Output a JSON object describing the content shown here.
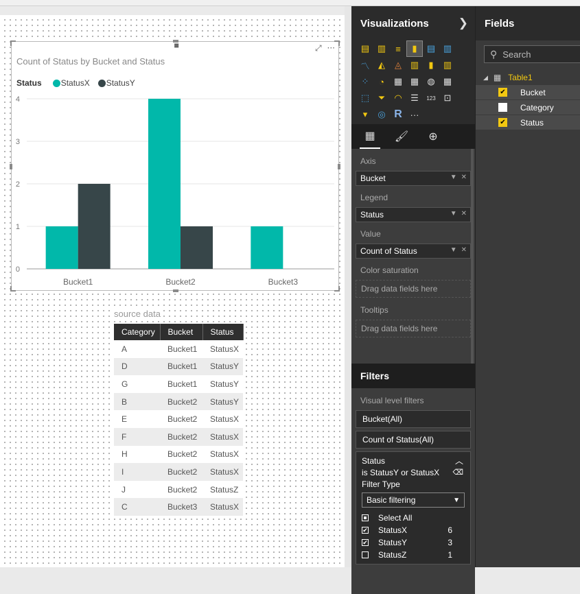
{
  "colors": {
    "statusx": "#01B8AA",
    "statusy": "#374649",
    "accent": "#F2C811"
  },
  "visual": {
    "title": "Count of Status by Bucket and Status",
    "legend_title": "Status",
    "legend": [
      "StatusX",
      "StatusY"
    ],
    "icons": [
      "focus-mode-icon",
      "more-options-icon"
    ]
  },
  "chart_data": {
    "type": "bar",
    "title": "Count of Status by Bucket and Status",
    "categories": [
      "Bucket1",
      "Bucket2",
      "Bucket3"
    ],
    "series": [
      {
        "name": "StatusX",
        "values": [
          1,
          4,
          1
        ]
      },
      {
        "name": "StatusY",
        "values": [
          2,
          1,
          0
        ]
      }
    ],
    "yticks": [
      "0",
      "1",
      "2",
      "3",
      "4"
    ],
    "ylim": [
      0,
      4
    ],
    "grid": true,
    "legend_position": "top-left"
  },
  "source": {
    "label": "source data",
    "headers": [
      "Category",
      "Bucket",
      "Status"
    ],
    "rows": [
      [
        "A",
        "Bucket1",
        "StatusX"
      ],
      [
        "D",
        "Bucket1",
        "StatusY"
      ],
      [
        "G",
        "Bucket1",
        "StatusY"
      ],
      [
        "B",
        "Bucket2",
        "StatusY"
      ],
      [
        "E",
        "Bucket2",
        "StatusX"
      ],
      [
        "F",
        "Bucket2",
        "StatusX"
      ],
      [
        "H",
        "Bucket2",
        "StatusX"
      ],
      [
        "I",
        "Bucket2",
        "StatusX"
      ],
      [
        "J",
        "Bucket2",
        "StatusZ"
      ],
      [
        "C",
        "Bucket3",
        "StatusX"
      ]
    ]
  },
  "viz_pane": {
    "title": "Visualizations",
    "wells": {
      "axis_label": "Axis",
      "axis_value": "Bucket",
      "legend_label": "Legend",
      "legend_value": "Status",
      "value_label": "Value",
      "value_value": "Count of Status",
      "color_label": "Color saturation",
      "color_drop": "Drag data fields here",
      "tooltips_label": "Tooltips",
      "tooltips_drop": "Drag data fields here"
    },
    "filters": {
      "title": "Filters",
      "level": "Visual level filters",
      "bucket": "Bucket(All)",
      "count": "Count of Status(All)",
      "status_title": "Status",
      "status_desc": "is StatusY or StatusX",
      "filter_type_label": "Filter Type",
      "filter_type": "Basic filtering",
      "select_all": "Select All",
      "options": [
        {
          "label": "StatusX",
          "count": "6",
          "checked": true
        },
        {
          "label": "StatusY",
          "count": "3",
          "checked": true
        },
        {
          "label": "StatusZ",
          "count": "1",
          "checked": false
        }
      ]
    }
  },
  "fields_pane": {
    "title": "Fields",
    "search_placeholder": "Search",
    "table": "Table1",
    "fields": [
      {
        "name": "Bucket",
        "checked": true
      },
      {
        "name": "Category",
        "checked": false
      },
      {
        "name": "Status",
        "checked": true
      }
    ]
  }
}
